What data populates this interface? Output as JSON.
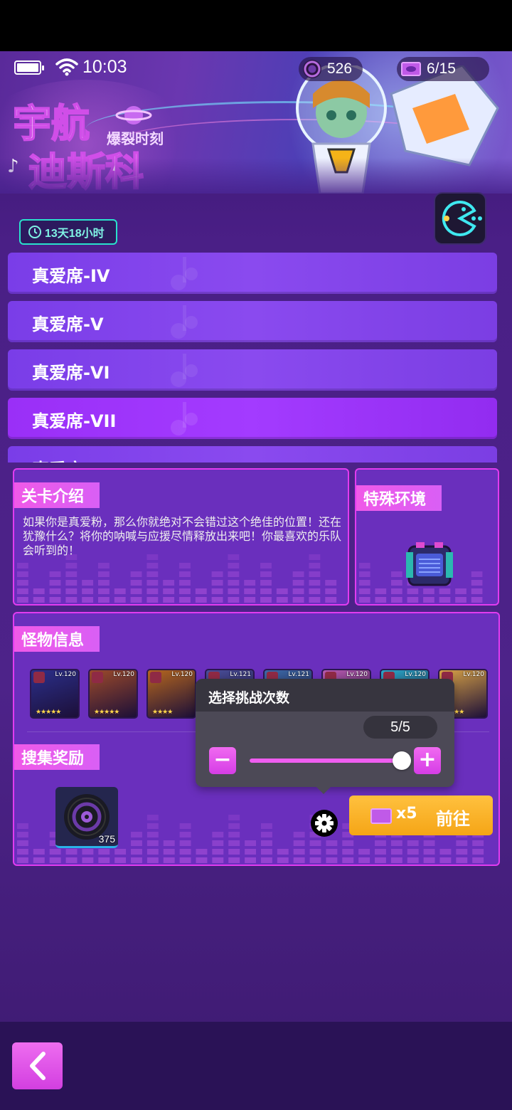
{
  "status_bar": {
    "time": "10:03",
    "coins": "526",
    "tickets": "6/15"
  },
  "banner": {
    "logo_lines": [
      "宇航",
      "迪斯科"
    ],
    "logo_sub": "爆裂时刻",
    "timer": "13天18小时"
  },
  "stages": [
    {
      "label": "真爱席-IV"
    },
    {
      "label": "真爱席-V"
    },
    {
      "label": "真爱席-VI"
    },
    {
      "label": "真爱席-VII"
    },
    {
      "label": "真爱席-VIII"
    }
  ],
  "intro": {
    "title": "关卡介绍",
    "text": "如果你是真爱粉，那么你就绝对不会错过这个绝佳的位置！还在犹豫什么？将你的呐喊与应援尽情释放出来吧！你最喜欢的乐队会听到的！"
  },
  "environment": {
    "title": "特殊环境",
    "icon": "speaker-icon"
  },
  "monsters": {
    "title": "怪物信息",
    "items": [
      {
        "lv": "Lv.120",
        "stars": "★★★★★",
        "color": "#2b2f8a"
      },
      {
        "lv": "Lv.120",
        "stars": "★★★★★",
        "color": "#9c4a2a"
      },
      {
        "lv": "Lv.120",
        "stars": "★★★★",
        "color": "#b5661e"
      },
      {
        "lv": "Lv.121",
        "stars": "",
        "color": "#4a4f9a"
      },
      {
        "lv": "Lv.121",
        "stars": "",
        "color": "#3c6aa8"
      },
      {
        "lv": "Lv.120",
        "stars": "",
        "color": "#b75ab0"
      },
      {
        "lv": "Lv.120",
        "stars": "",
        "color": "#2aa8c8"
      },
      {
        "lv": "Lv.120",
        "stars": "★★★★",
        "color": "#d8a245"
      }
    ]
  },
  "rewards": {
    "title": "搜集奖励",
    "item_count": "375"
  },
  "popover": {
    "title": "选择挑战次数",
    "count_text": "5/5",
    "minus": "−",
    "plus": "+",
    "value": 5,
    "max": 5
  },
  "action": {
    "cost": "x5",
    "go_label": "前往"
  },
  "colors": {
    "accent": "#ef5df0",
    "go": "#f5a516",
    "timer": "#29e2cc"
  }
}
